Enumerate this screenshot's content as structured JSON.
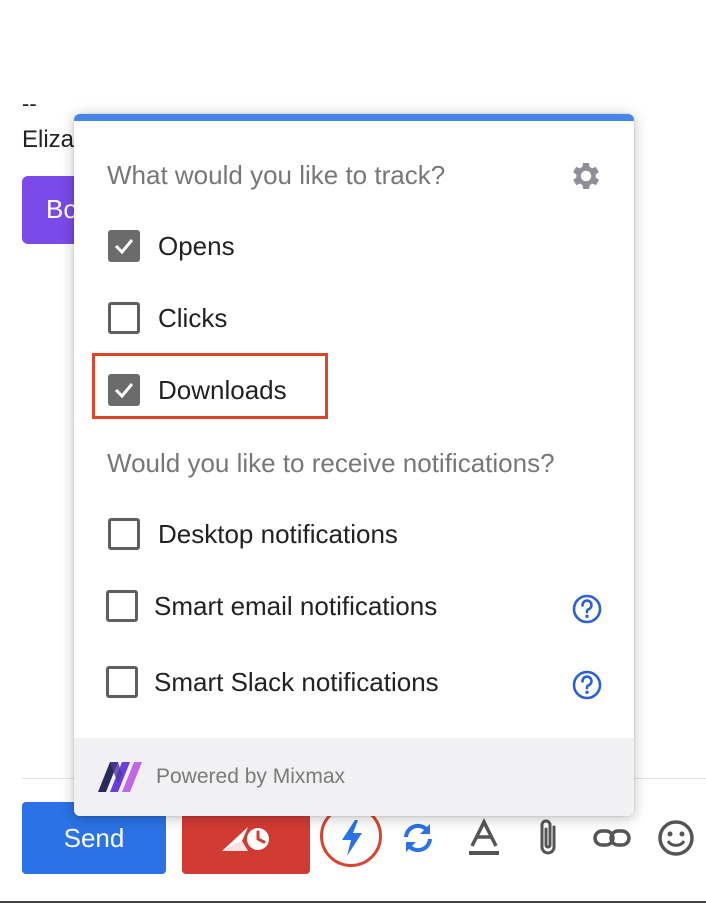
{
  "compose": {
    "signature_dashes": "--",
    "signature_name": "Eliza",
    "purple_button_label": "Bo"
  },
  "toolbar": {
    "send_label": "Send",
    "icons": [
      "send-later-icon",
      "tracking-bolt-icon",
      "sync-icon",
      "text-format-icon",
      "attachment-icon",
      "link-icon",
      "emoji-icon"
    ]
  },
  "popup": {
    "track_title": "What would you like to track?",
    "track_options": [
      {
        "label": "Opens",
        "checked": true
      },
      {
        "label": "Clicks",
        "checked": false
      },
      {
        "label": "Downloads",
        "checked": true
      }
    ],
    "notify_title": "Would you like to receive notifications?",
    "notify_options": [
      {
        "label": "Desktop notifications",
        "checked": false
      },
      {
        "label": "Smart email notifications",
        "checked": false
      },
      {
        "label": "Smart Slack notifications",
        "checked": false
      }
    ],
    "footer_text": "Powered by Mixmax"
  },
  "colors": {
    "accent_blue": "#4a85e6",
    "send_blue": "#2a72e5",
    "schedule_red": "#d23b32",
    "highlight_red": "#e0432c",
    "purple": "#7b4ae8"
  }
}
